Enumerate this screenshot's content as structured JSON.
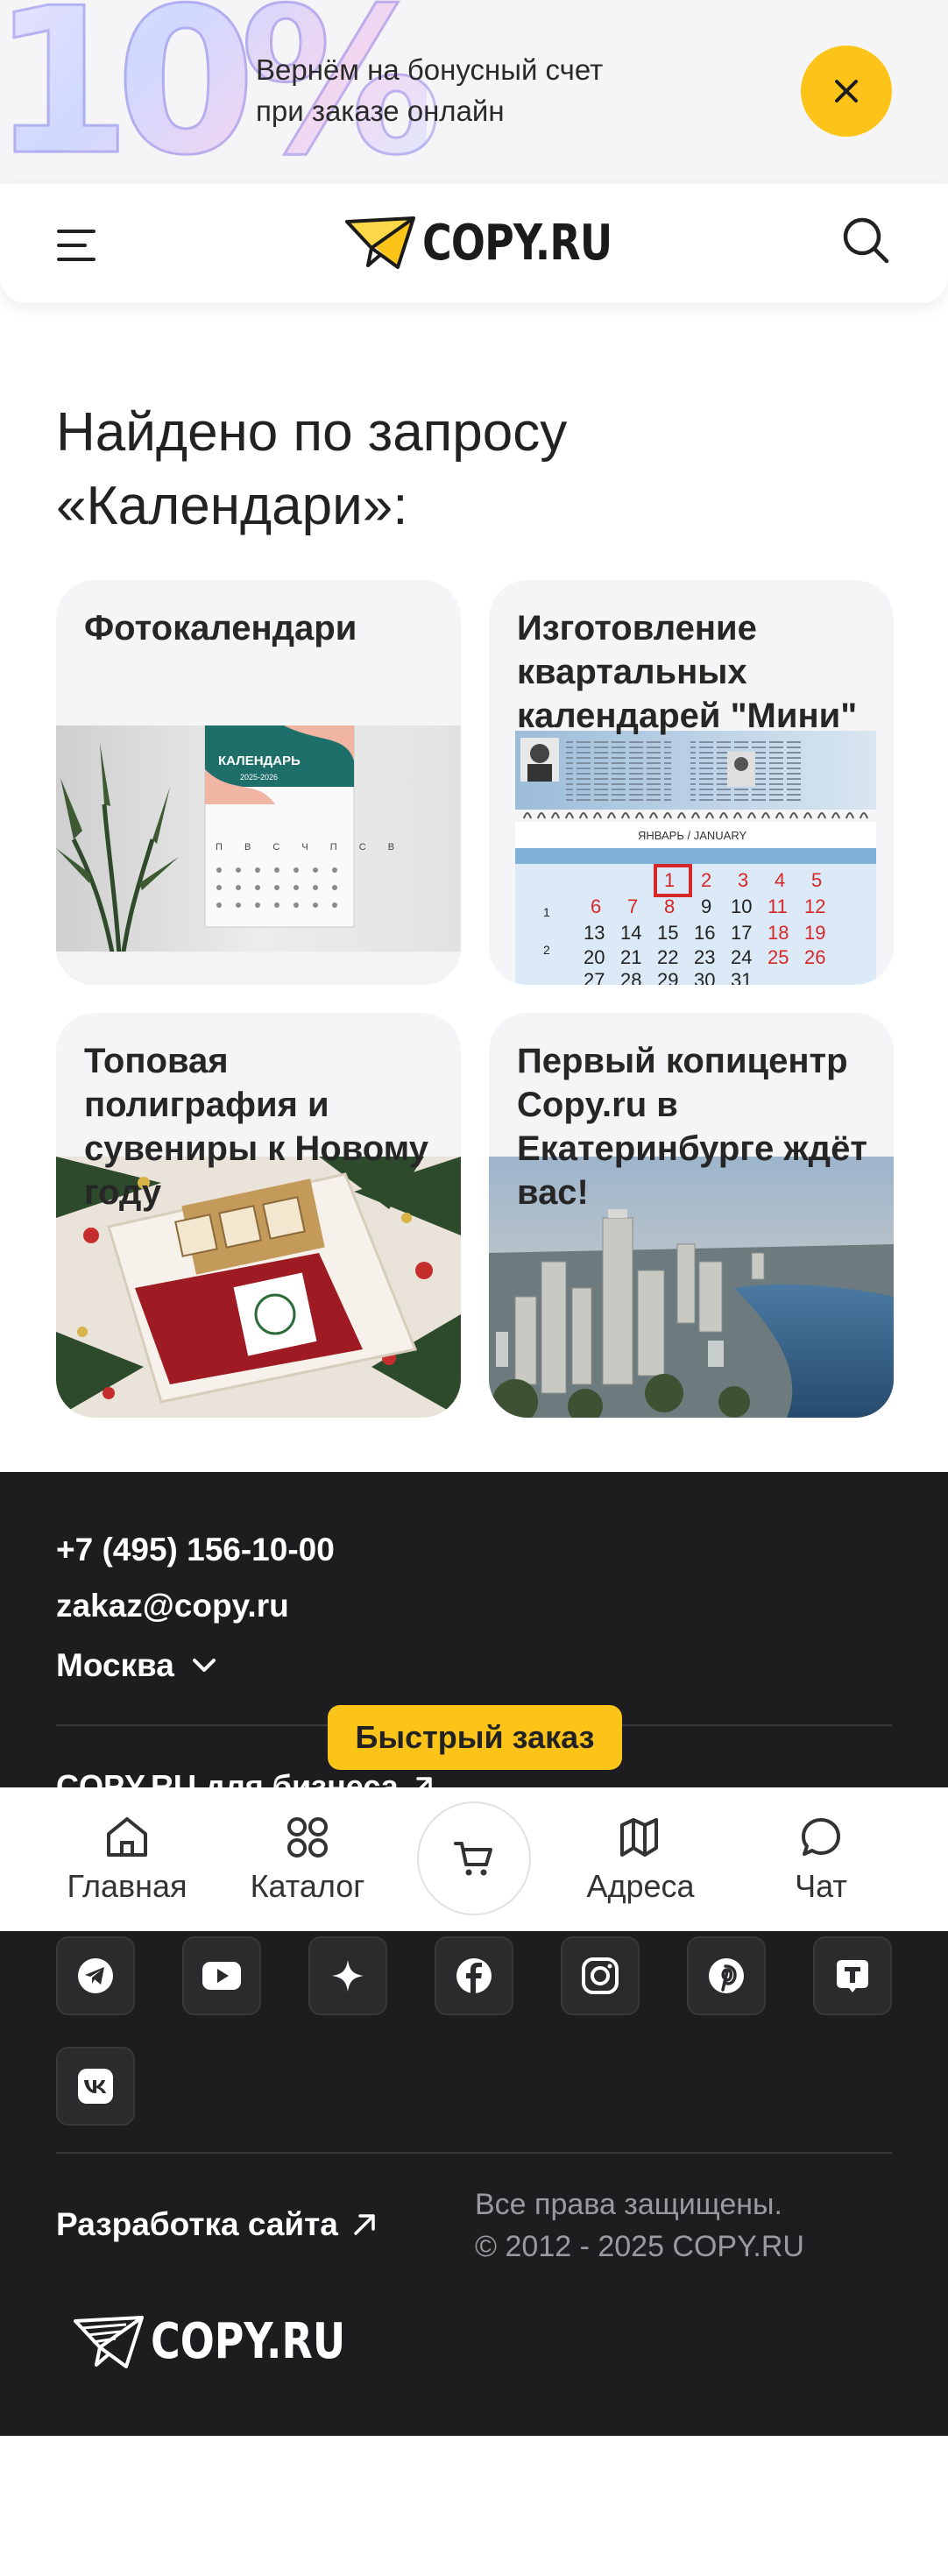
{
  "promo": {
    "big_text": "10%",
    "line1": "Вернём на бонусный счет",
    "line2": "при заказе онлайн",
    "close_icon": "close-icon",
    "accent": "#fcc419"
  },
  "header": {
    "logo_text": "COPY.RU",
    "menu_icon": "hamburger-icon",
    "search_icon": "search-icon"
  },
  "results": {
    "title_line1": "Найдено по запросу",
    "title_line2": "«Календари»:",
    "cards": [
      {
        "title": "Фотокалендари"
      },
      {
        "title": "Изготовление квартальных календарей \"Мини\""
      },
      {
        "title": "Топовая полиграфия и сувениры к Новому году"
      },
      {
        "title": "Первый копицентр Copy.ru в Екатеринбурге ждёт вас!"
      }
    ],
    "calendar_img": {
      "title": "КАЛЕНДАРЬ",
      "years": "2025-2026",
      "days": "П В С Ч П С В"
    },
    "mini_calendar_img": {
      "month": "ЯНВАРЬ / JANUARY"
    }
  },
  "footer": {
    "phone": "+7 (495) 156-10-00",
    "email": "zakaz@copy.ru",
    "city": "Москва",
    "business_link": "COPY.RU для бизнеса",
    "socials": [
      "telegram-icon",
      "youtube-icon",
      "sparkle-icon",
      "facebook-icon",
      "instagram-icon",
      "pinterest-icon",
      "tiktok-icon",
      "vk-icon"
    ],
    "dev_link": "Разработка сайта",
    "rights_line1": "Все права защищены.",
    "rights_line2": "© 2012 - 2025 COPY.RU",
    "logo_text": "COPY.RU",
    "background": "#1d1d1f"
  },
  "quick_order": {
    "label": "Быстрый заказ"
  },
  "bottom_nav": {
    "items": [
      {
        "label": "Главная",
        "icon": "home-icon"
      },
      {
        "label": "Каталог",
        "icon": "catalog-icon"
      },
      {
        "label": "",
        "icon": "cart-icon"
      },
      {
        "label": "Адреса",
        "icon": "map-icon"
      },
      {
        "label": "Чат",
        "icon": "chat-icon"
      }
    ]
  }
}
